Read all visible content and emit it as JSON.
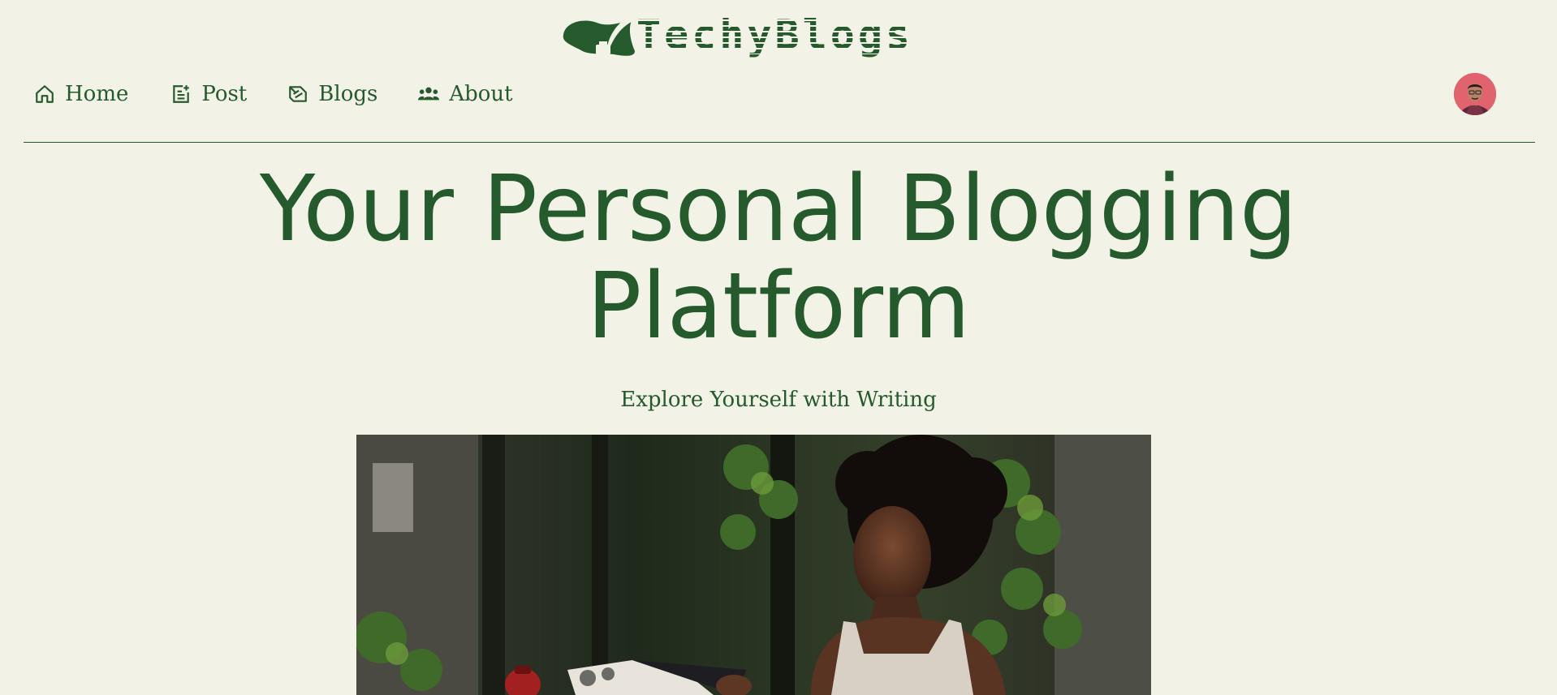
{
  "brand": {
    "name": "TechyBlogs",
    "logo_icon": "quill-ink-icon",
    "color": "#245a2c",
    "background": "#f3f2e7"
  },
  "nav": {
    "items": [
      {
        "label": "Home",
        "icon": "home-icon"
      },
      {
        "label": "Post",
        "icon": "post-icon"
      },
      {
        "label": "Blogs",
        "icon": "blogs-icon"
      },
      {
        "label": "About",
        "icon": "users-icon"
      }
    ]
  },
  "user": {
    "avatar_icon": "user-avatar"
  },
  "hero": {
    "title_line1": "Your Personal Blogging",
    "title_line2": "Platform",
    "subtitle": "Explore Yourself with Writing",
    "image": "woman-reading-magazine-photo"
  }
}
